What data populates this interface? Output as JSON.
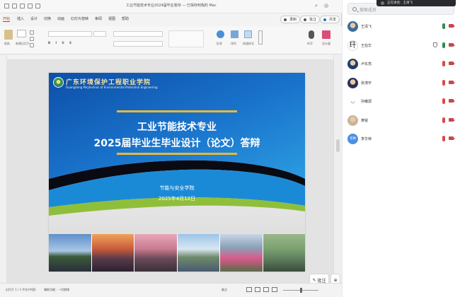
{
  "ppt": {
    "title": "工业节能技术专业2024届毕业答辩 — 已保存到我的 Mac",
    "tabs": [
      "开始",
      "插入",
      "设计",
      "切换",
      "动画",
      "幻灯片放映",
      "审阅",
      "视图",
      "帮助"
    ],
    "active_tab_index": 0,
    "right_buttons": [
      "录制",
      "批注",
      "共享"
    ],
    "ribbon_labels": [
      "粘贴",
      "新建幻灯片",
      "形状",
      "排列",
      "快速样式",
      "听写",
      "设计器"
    ],
    "float_buttons": {
      "comment": "批注",
      "zoom_icon": "zoom-icon"
    },
    "status": {
      "slide_info": "幻灯片 1 / 1  中文(中国)",
      "accessibility": "辅助功能：一切就绪",
      "notes": "备注"
    }
  },
  "slide": {
    "school_cn": "广东环境保护工程职业学院",
    "school_en": "Guangdong Polytechnic of Environmental Protection Engineering",
    "title_line1": "工业节能技术专业",
    "title_line2": "2025届毕业生毕业设计（论文）答辩",
    "college": "节能与安全学院",
    "date": "2025年4月12日",
    "photo_count": 6
  },
  "meeting": {
    "mini_title": "正在讲话：王清飞",
    "search_placeholder": "搜索成员",
    "participants": [
      {
        "name": "王清飞",
        "avatar": "photo",
        "color": "#3d6b9e",
        "mic": "on",
        "shield": false
      },
      {
        "name": "王伯华",
        "avatar": "calligraphy",
        "color": "#ffffff",
        "mic": "on",
        "shield": true
      },
      {
        "name": "卢东亮",
        "avatar": "photo",
        "color": "#1f3d6b",
        "mic": "off",
        "shield": false
      },
      {
        "name": "张涛宇",
        "avatar": "photo",
        "color": "#2a2f55",
        "mic": "off",
        "shield": false
      },
      {
        "name": "孙曦源",
        "avatar": "face",
        "color": "#ffffff",
        "mic": "off",
        "shield": false
      },
      {
        "name": "黄锐",
        "avatar": "photo",
        "color": "#c8b49a",
        "mic": "off",
        "shield": false
      },
      {
        "name": "李华钟",
        "avatar": "text",
        "avatar_text": "华钟",
        "color": "#4d8fe0",
        "mic": "off",
        "shield": false
      }
    ],
    "colors": {
      "mic_on": "#2e8b57",
      "mic_off": "#d94a4a",
      "cam": "#c6474d"
    }
  }
}
